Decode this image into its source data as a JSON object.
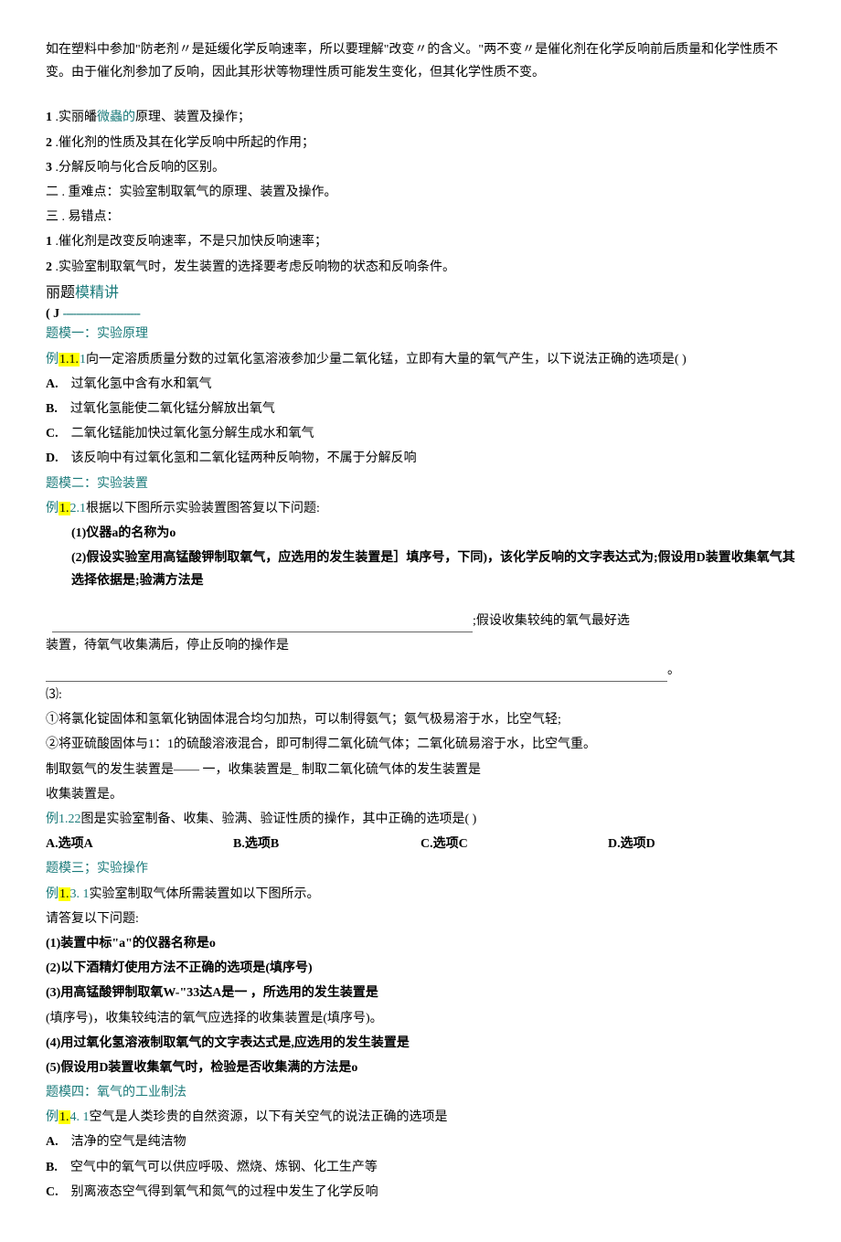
{
  "intro": "如在塑料中参加\"防老剂〃是延缓化学反响速率，所以要理解\"改变〃的含义。\"两不变〃是催化剂在化学反响前后质量和化学性质不变。由于催化剂参加了反响，因此其形状等物理性质可能发生变化，但其化学性质不变。",
  "points": {
    "p1_num": "1",
    "p1_a": " .实丽皤",
    "p1_link": "微蟲的",
    "p1_b": "原理、装置及操作；",
    "p2_num": "2",
    "p2": " .催化剂的性质及其在化学反响中所起的作用；",
    "p3_num": "3",
    "p3": " .分解反响与化合反响的区别。",
    "p4_num": "二",
    "p4": "   . 重难点：实验室制取氧气的原理、装置及操作。",
    "p5_num": "三",
    "p5": "   . 易错点：",
    "p6_num": "1",
    "p6": " .催化剂是改变反响速率，不是只加快反响速率；",
    "p7_num": "2",
    "p7": " .实验室制取氧气时，发生装置的选择要考虑反响物的状态和反响条件。"
  },
  "sec_title_a": "丽题",
  "sec_title_b": "模精讲",
  "sec_sub": "(        J ",
  "sec_dash": "-----------------------",
  "tm1": "题模一：实验原理",
  "ex111_pre": "例",
  "ex111_hi": "1.1.",
  "ex111_mid": "1",
  "ex111_txt": "向一定溶质质量分数的过氧化氢溶液参加少量二氧化锰，立即有大量的氧气产生，以下说法正确的选项是(    )",
  "ex111_a_l": "A.",
  "ex111_a": "过氧化氢中含有水和氧气",
  "ex111_b_l": "B.",
  "ex111_b": "过氧化氢能使二氧化锰分解放出氧气",
  "ex111_c_l": "C.",
  "ex111_c": "二氧化锰能加快过氧化氢分解生成水和氧气",
  "ex111_d_l": "D.",
  "ex111_d": "该反响中有过氧化氢和二氧化锰两种反响物，不属于分解反响",
  "tm2": "题模二：实验装置",
  "ex121_pre": "例",
  "ex121_hi": "1.",
  "ex121_mid": "2.1",
  "ex121_txt": "根据以下图所示实验装置图答复以下问题:",
  "ex121_1": "(1)仪器a的名称为o",
  "ex121_2": "(2)假设实验室用高锰酸钾制取氧气，应选用的发生装置是］填序号，下同)，该化学反响的文字表达式为;假设用D装置收集氧气其选择依据是;验满方法是",
  "ex121_after1": ";假设收集较纯的氧气最好选",
  "ex121_after2": "装置，待氧气收集满后，停止反响的操作是",
  "ex121_after3": "。",
  "ex121_3h": "⑶:",
  "ex121_3a": "①将氯化锭固体和氢氧化钠固体混合均匀加热，可以制得氨气；氨气极易溶于水，比空气轻;",
  "ex121_3b": "②将亚硫酸固体与1：1的硫酸溶液混合，即可制得二氧化硫气体；二氧化硫易溶于水，比空气重。",
  "ex121_3c": "制取氨气的发生装置是——                          一，收集装置是_                 制取二氧化硫气体的发生装置是",
  "ex121_3d": "收集装置是。",
  "ex122_pre": "例",
  "ex122_hi": "1.",
  "ex122_mid": "22",
  "ex122_txt": "图是实验室制备、收集、验满、验证性质的操作，其中正确的选项是(                     )",
  "ex122_a": "A.选项A",
  "ex122_b": "B.选项B",
  "ex122_c": "C.选项C",
  "ex122_d": "D.选项D",
  "tm3": "题模三；实验操作",
  "ex131_pre": "例",
  "ex131_hi": "1.",
  "ex131_mid": "3. 1",
  "ex131_txt": "实验室制取气体所需装置如以下图所示。",
  "ex131_q": "请答复以下问题:",
  "ex131_1": "(1)装置中标\"a\"的仪器名称是o",
  "ex131_2": "(2)以下酒精灯使用方法不正确的选项是(填序号)",
  "ex131_3": "(3)用高锰酸钾制取氧W-\"33达A是一                                                                     ，所选用的发生装置是",
  "ex131_3b": "(填序号)，收集较纯洁的氧气应选择的收集装置是(填序号)。",
  "ex131_4": "(4)用过氧化氢溶液制取氧气的文字表达式是,应选用的发生装置是",
  "ex131_5": "(5)假设用D装置收集氧气时，检验是否收集满的方法是o",
  "tm4": "题模四：氧气的工业制法",
  "ex141_pre": "例",
  "ex141_hi": "1.",
  "ex141_mid": "4. 1",
  "ex141_txt": "空气是人类珍贵的自然资源，以下有关空气的说法正确的选项是",
  "ex141_a_l": "A.",
  "ex141_a": "洁净的空气是纯洁物",
  "ex141_b_l": "B.",
  "ex141_b": "空气中的氧气可以供应呼吸、燃烧、炼钢、化工生产等",
  "ex141_c_l": "C.",
  "ex141_c": "别离液态空气得到氧气和氮气的过程中发生了化学反响"
}
